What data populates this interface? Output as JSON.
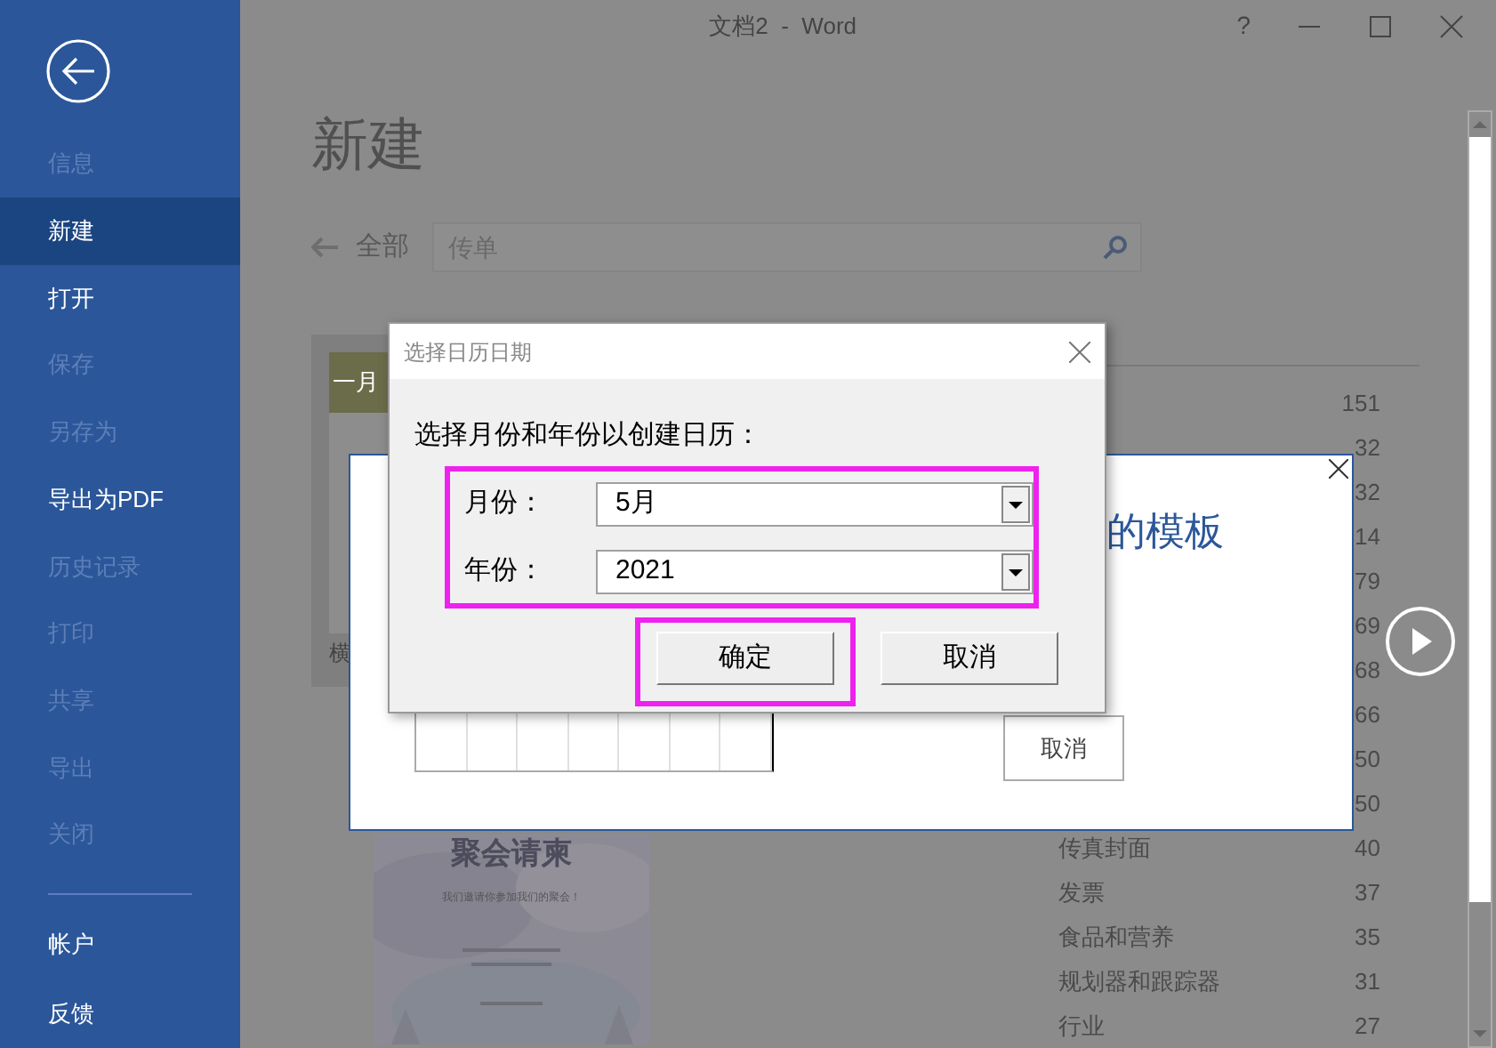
{
  "window": {
    "title": "文档2  -  Word",
    "help": "?"
  },
  "sidebar": {
    "items": [
      {
        "label": "信息",
        "disabled": true,
        "selected": false
      },
      {
        "label": "新建",
        "disabled": false,
        "selected": true
      },
      {
        "label": "打开",
        "disabled": false,
        "selected": false
      },
      {
        "label": "保存",
        "disabled": true,
        "selected": false
      },
      {
        "label": "另存为",
        "disabled": true,
        "selected": false
      },
      {
        "label": "导出为PDF",
        "disabled": false,
        "selected": false
      },
      {
        "label": "历史记录",
        "disabled": true,
        "selected": false
      },
      {
        "label": "打印",
        "disabled": true,
        "selected": false
      },
      {
        "label": "共享",
        "disabled": true,
        "selected": false
      },
      {
        "label": "导出",
        "disabled": true,
        "selected": false
      },
      {
        "label": "关闭",
        "disabled": true,
        "selected": false
      }
    ],
    "footer_items": [
      {
        "label": "帐户",
        "disabled": false,
        "selected": false
      },
      {
        "label": "反馈",
        "disabled": false,
        "selected": false
      }
    ]
  },
  "page": {
    "heading": "新建",
    "back_label": "全部",
    "search": {
      "placeholder": "传单"
    }
  },
  "templates": [
    {
      "kind": "calendar",
      "header": "一月",
      "caption": "横"
    },
    {
      "kind": "invitation",
      "title": "聚会请柬",
      "subtitle": "我们邀请你参加我们的聚会！"
    }
  ],
  "categories": [
    {
      "count": "151"
    },
    {
      "count": "32"
    },
    {
      "count": "32"
    },
    {
      "count": "14"
    },
    {
      "count": "79"
    },
    {
      "count": "69"
    },
    {
      "count": "68"
    },
    {
      "count": "66"
    },
    {
      "count": "50"
    },
    {
      "count": "50"
    },
    {
      "name": "传真封面",
      "count": "40"
    },
    {
      "name": "发票",
      "count": "37"
    },
    {
      "name": "食品和营养",
      "count": "35"
    },
    {
      "name": "规划器和跟踪器",
      "count": "31"
    },
    {
      "name": "行业",
      "count": "27"
    }
  ],
  "preview": {
    "heading": "的模板",
    "cancel": "取消"
  },
  "dialog": {
    "title": "选择日历日期",
    "prompt": "选择月份和年份以创建日历：",
    "fields_highlighted": true,
    "fields": [
      {
        "label": "月份：",
        "value": "5月"
      },
      {
        "label": "年份：",
        "value": "2021"
      }
    ],
    "buttons": [
      {
        "label": "确定",
        "highlighted": true
      },
      {
        "label": "取消",
        "highlighted": false
      }
    ]
  }
}
